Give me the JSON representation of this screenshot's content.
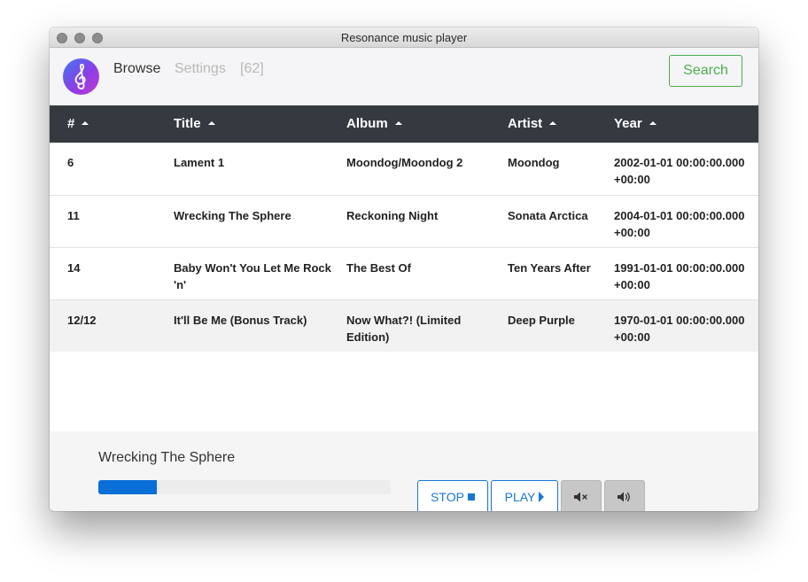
{
  "window": {
    "title": "Resonance music player"
  },
  "nav": {
    "browse": "Browse",
    "settings": "Settings",
    "count": "[62]",
    "search": "Search"
  },
  "table": {
    "headers": [
      "#",
      "Title",
      "Album",
      "Artist",
      "Year"
    ],
    "rows": [
      {
        "num": "6",
        "title": "Lament 1",
        "album": "Moondog/Moondog 2",
        "artist": "Moondog",
        "year": "2002-01-01 00:00:00.000 +00:00",
        "active": false
      },
      {
        "num": "11",
        "title": "Wrecking The Sphere",
        "album": "Reckoning Night",
        "artist": "Sonata Arctica",
        "year": "2004-01-01 00:00:00.000 +00:00",
        "active": false
      },
      {
        "num": "14",
        "title": "Baby Won't You Let Me Rock 'n'",
        "album": "The Best Of",
        "artist": "Ten Years After",
        "year": "1991-01-01 00:00:00.000 +00:00",
        "active": false
      },
      {
        "num": "12/12",
        "title": "It'll Be Me (Bonus Track)",
        "album": "Now What?! (Limited Edition)",
        "artist": "Deep Purple",
        "year": "1970-01-01 00:00:00.000 +00:00",
        "active": true
      }
    ]
  },
  "player": {
    "now_playing": "Wrecking The Sphere",
    "progress": 0.2,
    "stop": "STOP",
    "play": "PLAY",
    "mute_icon": "speaker-mute-icon",
    "volume_icon": "speaker-volume-icon"
  },
  "colors": {
    "accent": "#1877d6",
    "search": "#4cae4c",
    "header_bg": "#343a40",
    "progress": "#0a6fd6"
  }
}
